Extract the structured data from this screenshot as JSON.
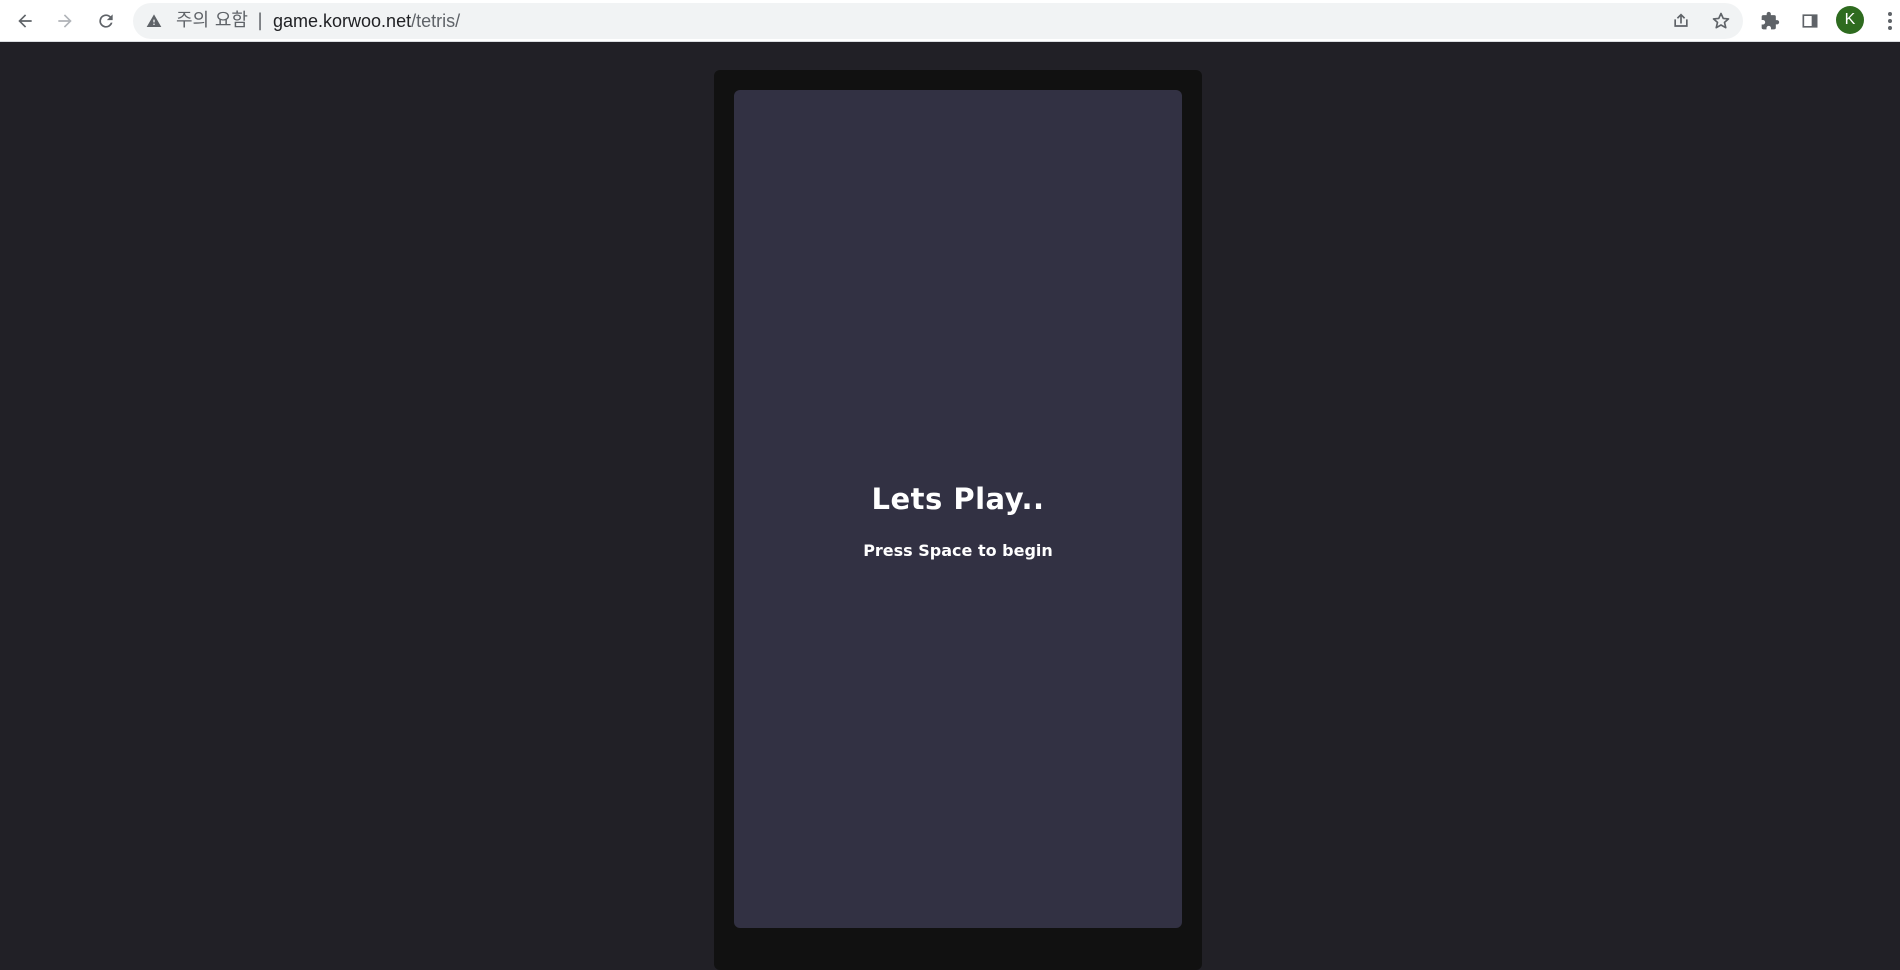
{
  "browser": {
    "security_label": "주의 요함",
    "separator": "|",
    "url_host": "game.korwoo.net",
    "url_path": "/tetris/",
    "profile_initial": "K",
    "profile_color": "#2e6b1f"
  },
  "icons": {
    "back": "arrow-left-icon",
    "forward": "arrow-right-icon",
    "reload": "reload-icon",
    "warning": "warning-triangle-icon",
    "share": "share-icon",
    "bookmark": "star-icon",
    "extensions": "puzzle-icon",
    "side_panel": "side-panel-icon",
    "menu": "kebab-menu-icon"
  },
  "game": {
    "title": "Lets Play..",
    "prompt": "Press Space to begin",
    "colors": {
      "page_bg": "#212026",
      "frame_bg": "#111111",
      "board_bg": "#323143",
      "text": "#ffffff"
    }
  }
}
